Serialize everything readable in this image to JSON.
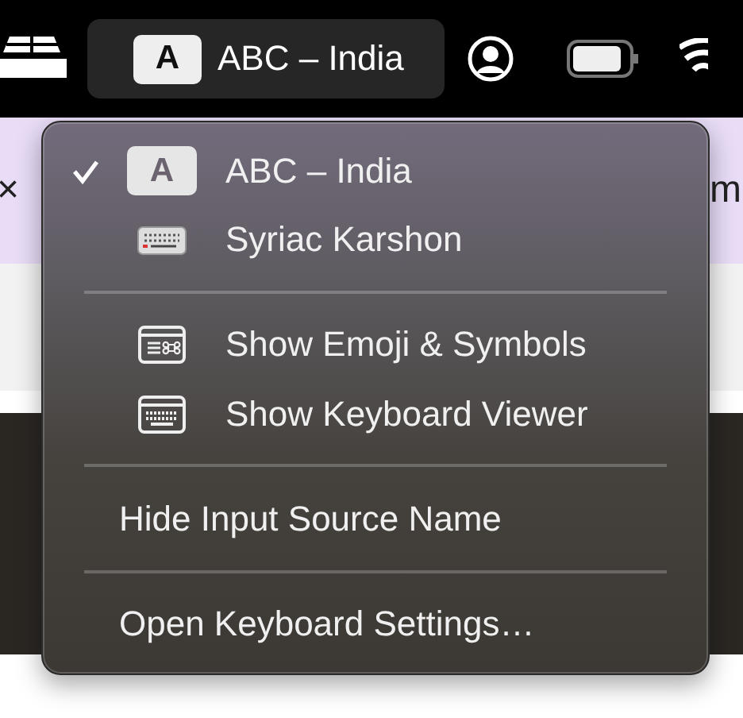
{
  "menu_bar": {
    "input_button": {
      "badge": "A",
      "label": "ABC – India",
      "selected": true
    }
  },
  "background": {
    "left_text": "×",
    "right_text": "m"
  },
  "menu": {
    "items": [
      {
        "kind": "source",
        "badge": "A",
        "label": "ABC – India",
        "checked": true
      },
      {
        "kind": "source",
        "label": "Syriac Karshon",
        "checked": false
      },
      {
        "kind": "separator"
      },
      {
        "kind": "action",
        "label": "Show Emoji & Symbols"
      },
      {
        "kind": "action",
        "label": "Show Keyboard Viewer"
      },
      {
        "kind": "separator"
      },
      {
        "kind": "plain",
        "label": "Hide Input Source Name"
      },
      {
        "kind": "separator"
      },
      {
        "kind": "plain",
        "label": "Open Keyboard Settings…"
      }
    ]
  }
}
